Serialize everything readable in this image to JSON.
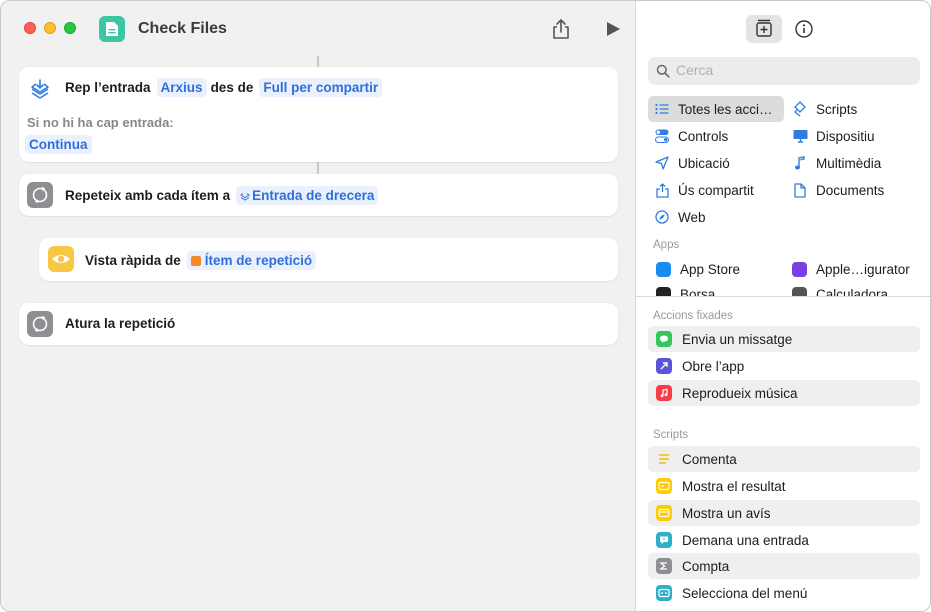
{
  "window": {
    "title": "Check Files"
  },
  "editor": {
    "receive": {
      "verb": "Rep l’entrada",
      "input_type": "Arxius",
      "from_word": "des de",
      "source": "Full per compartir",
      "no_input_label": "Si no hi ha cap entrada:",
      "no_input_action": "Continua"
    },
    "repeat": {
      "label": "Repeteix amb cada ítem a",
      "variable": "Entrada de drecera"
    },
    "quicklook": {
      "label": "Vista ràpida de",
      "variable": "Ítem de repetició"
    },
    "end_repeat": {
      "label": "Atura la repetició"
    }
  },
  "library": {
    "search_placeholder": "Cerca",
    "categories": [
      {
        "label": "Totes les acci…",
        "icon": "list-icon",
        "selected": true
      },
      {
        "label": "Scripts",
        "icon": "scripts-icon",
        "selected": false
      },
      {
        "label": "Controls",
        "icon": "toggle-icon",
        "selected": false
      },
      {
        "label": "Dispositiu",
        "icon": "display-icon",
        "selected": false
      },
      {
        "label": "Ubicació",
        "icon": "location-arrow-icon",
        "selected": false
      },
      {
        "label": "Multimèdia",
        "icon": "music-note-icon",
        "selected": false
      },
      {
        "label": "Ús compartit",
        "icon": "share-icon",
        "selected": false
      },
      {
        "label": "Documents",
        "icon": "document-icon",
        "selected": false
      },
      {
        "label": "Web",
        "icon": "compass-icon",
        "selected": false
      }
    ],
    "apps_header": "Apps",
    "apps": [
      {
        "label": "App Store",
        "color": "#1a8cf0"
      },
      {
        "label": "Apple…igurator",
        "color": "#7b3fe4"
      },
      {
        "label": "Borsa",
        "color": "#222222"
      },
      {
        "label": "Calculadora",
        "color": "#555555"
      }
    ],
    "pinned_header": "Accions fixades",
    "pinned": [
      {
        "label": "Envia un missatge",
        "color": "#34c759",
        "icon": "message-icon"
      },
      {
        "label": "Obre l’app",
        "color": "#5856d6",
        "icon": "open-arrow-icon"
      },
      {
        "label": "Reprodueix música",
        "color": "#fc3c44",
        "icon": "music-note-icon"
      }
    ],
    "scripts_header": "Scripts",
    "scripts": [
      {
        "label": "Comenta",
        "color": "#ffd60a",
        "icon": "comment-lines-icon"
      },
      {
        "label": "Mostra el resultat",
        "color": "#ffcc00",
        "icon": "result-icon"
      },
      {
        "label": "Mostra un avís",
        "color": "#ffcc00",
        "icon": "alert-icon"
      },
      {
        "label": "Demana una entrada",
        "color": "#30b0c7",
        "icon": "ask-icon"
      },
      {
        "label": "Compta",
        "color": "#8e8e93",
        "icon": "sigma-icon"
      },
      {
        "label": "Selecciona del menú",
        "color": "#30b0c7",
        "icon": "menu-select-icon"
      }
    ]
  }
}
